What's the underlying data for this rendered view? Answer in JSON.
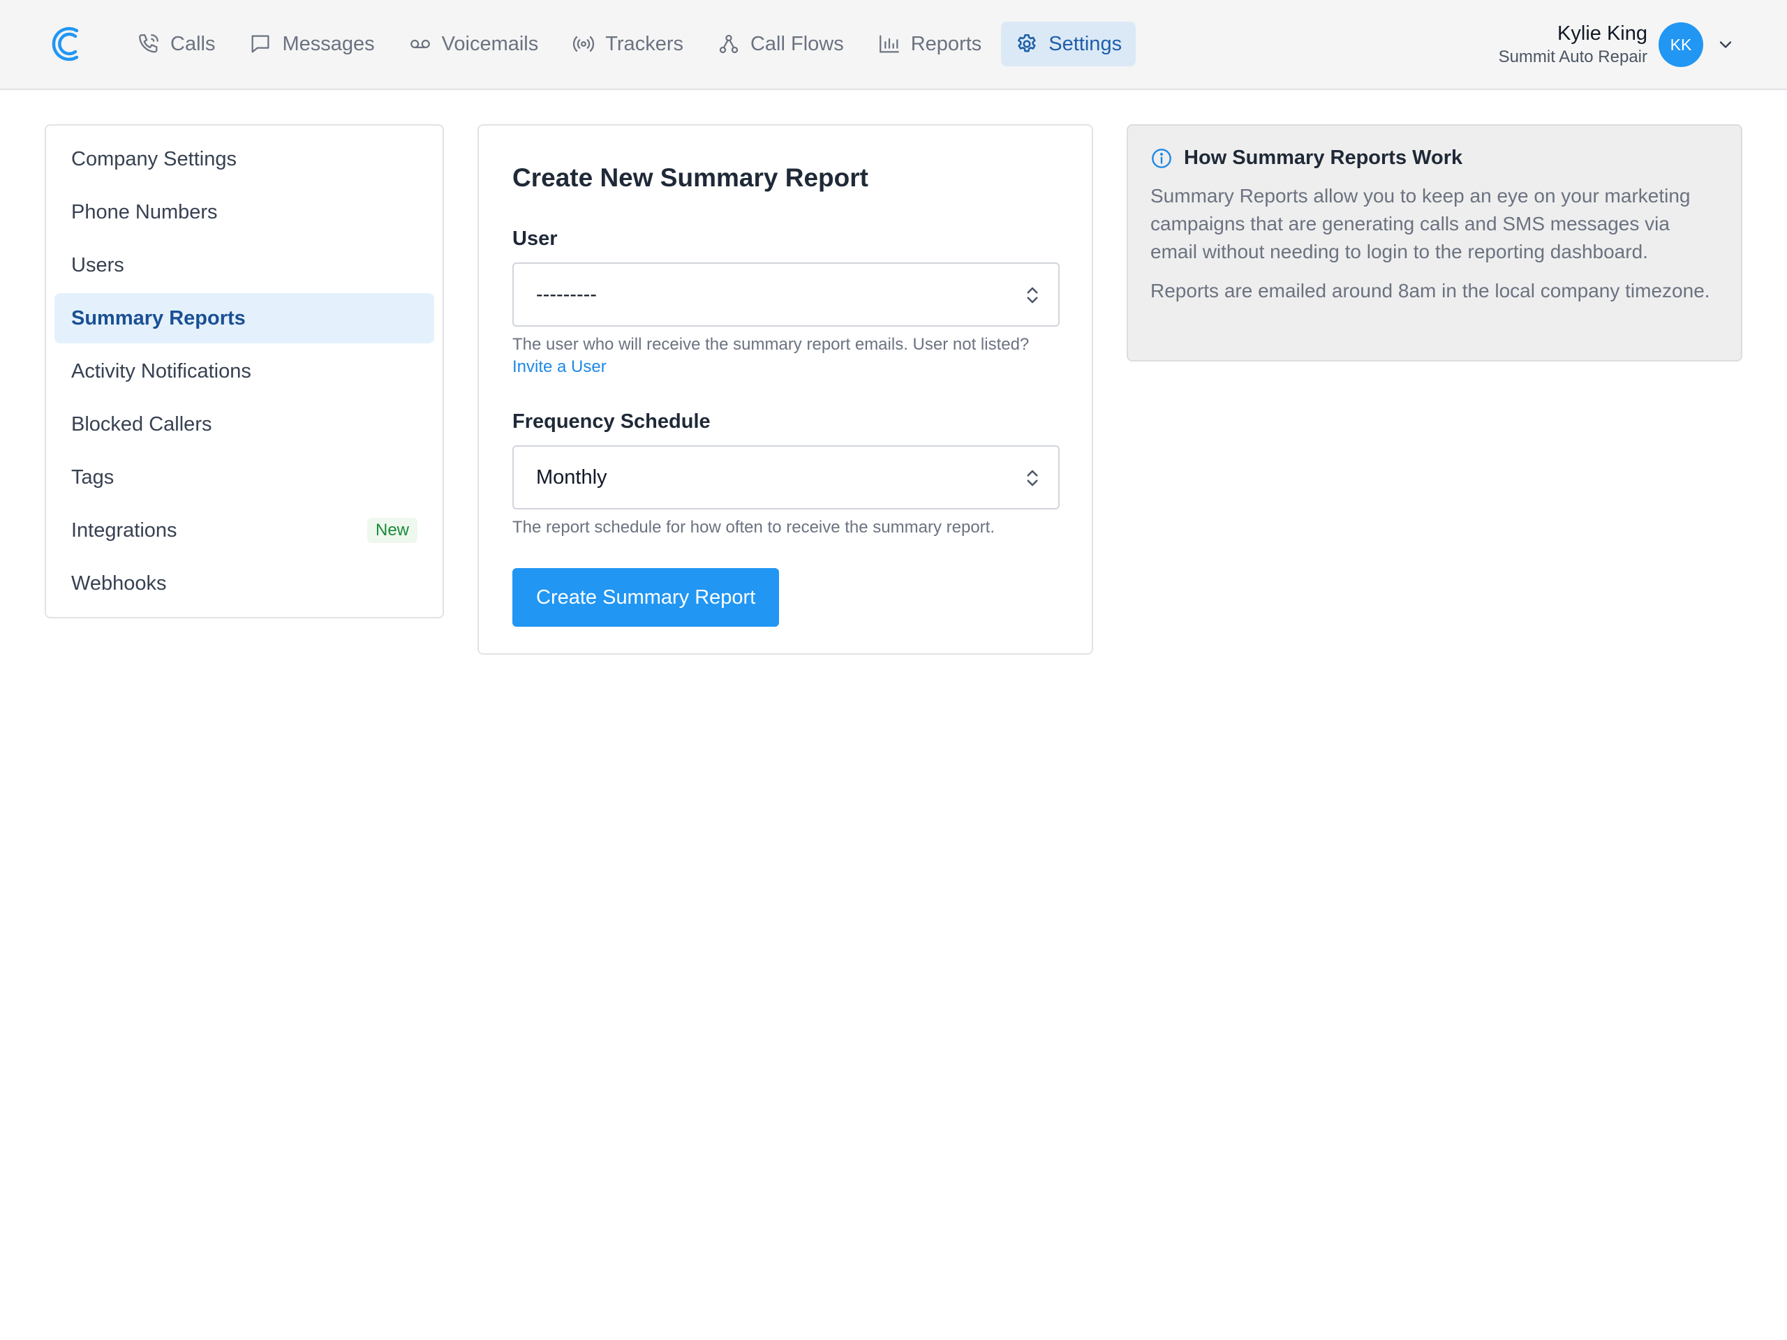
{
  "nav": {
    "items": [
      {
        "label": "Calls",
        "icon": "phone-icon"
      },
      {
        "label": "Messages",
        "icon": "message-icon"
      },
      {
        "label": "Voicemails",
        "icon": "voicemail-icon"
      },
      {
        "label": "Trackers",
        "icon": "broadcast-icon"
      },
      {
        "label": "Call Flows",
        "icon": "flow-icon"
      },
      {
        "label": "Reports",
        "icon": "bar-chart-icon"
      },
      {
        "label": "Settings",
        "icon": "gear-icon"
      }
    ],
    "active": "Settings"
  },
  "user": {
    "name": "Kylie King",
    "company": "Summit Auto Repair",
    "initials": "KK"
  },
  "sidebar": {
    "items": [
      {
        "label": "Company Settings"
      },
      {
        "label": "Phone Numbers"
      },
      {
        "label": "Users"
      },
      {
        "label": "Summary Reports"
      },
      {
        "label": "Activity Notifications"
      },
      {
        "label": "Blocked Callers"
      },
      {
        "label": "Tags"
      },
      {
        "label": "Integrations",
        "badge": "New"
      },
      {
        "label": "Webhooks"
      }
    ],
    "active": "Summary Reports"
  },
  "form": {
    "title": "Create New Summary Report",
    "user_label": "User",
    "user_value": "---------",
    "user_help": "The user who will receive the summary report emails. User not listed?",
    "user_help_link": "Invite a User",
    "frequency_label": "Frequency Schedule",
    "frequency_value": "Monthly",
    "frequency_help": "The report schedule for how often to receive the summary report.",
    "submit_label": "Create Summary Report"
  },
  "info": {
    "title": "How Summary Reports Work",
    "paragraph1": "Summary Reports allow you to keep an eye on your marketing campaigns that are generating calls and SMS messages via email without needing to login to the reporting dashboard.",
    "paragraph2": "Reports are emailed around 8am in the local company timezone."
  },
  "colors": {
    "accent": "#2196f3",
    "active_nav_bg": "#dbe9f7",
    "active_side_bg": "#e4f1fd",
    "badge_green": "#1a8a3a"
  }
}
